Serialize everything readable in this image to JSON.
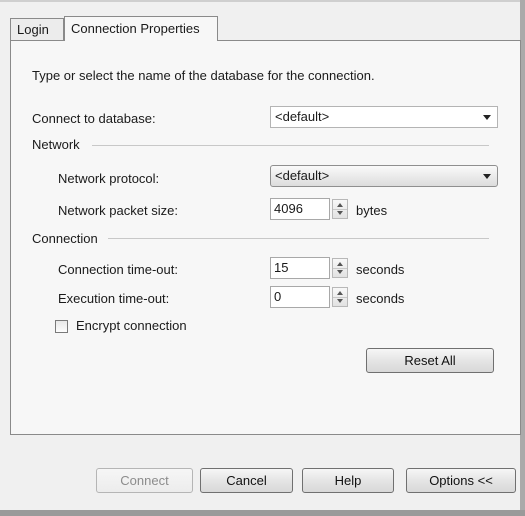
{
  "tabs": [
    {
      "label": "Login"
    },
    {
      "label": "Connection Properties"
    }
  ],
  "intro_text": "Type or select the name of the database for the connection.",
  "connect_to_database": {
    "label": "Connect to database:",
    "value": "<default>"
  },
  "network": {
    "group_label": "Network",
    "protocol": {
      "label": "Network protocol:",
      "value": "<default>"
    },
    "packet_size": {
      "label": "Network packet size:",
      "value": "4096",
      "unit": "bytes"
    }
  },
  "connection": {
    "group_label": "Connection",
    "connection_timeout": {
      "label": "Connection time-out:",
      "value": "15",
      "unit": "seconds"
    },
    "execution_timeout": {
      "label": "Execution time-out:",
      "value": "0",
      "unit": "seconds"
    },
    "encrypt": {
      "label": "Encrypt connection",
      "checked": false
    }
  },
  "reset_all_label": "Reset All",
  "buttons": {
    "connect": "Connect",
    "cancel": "Cancel",
    "help": "Help",
    "options": "Options <<"
  }
}
